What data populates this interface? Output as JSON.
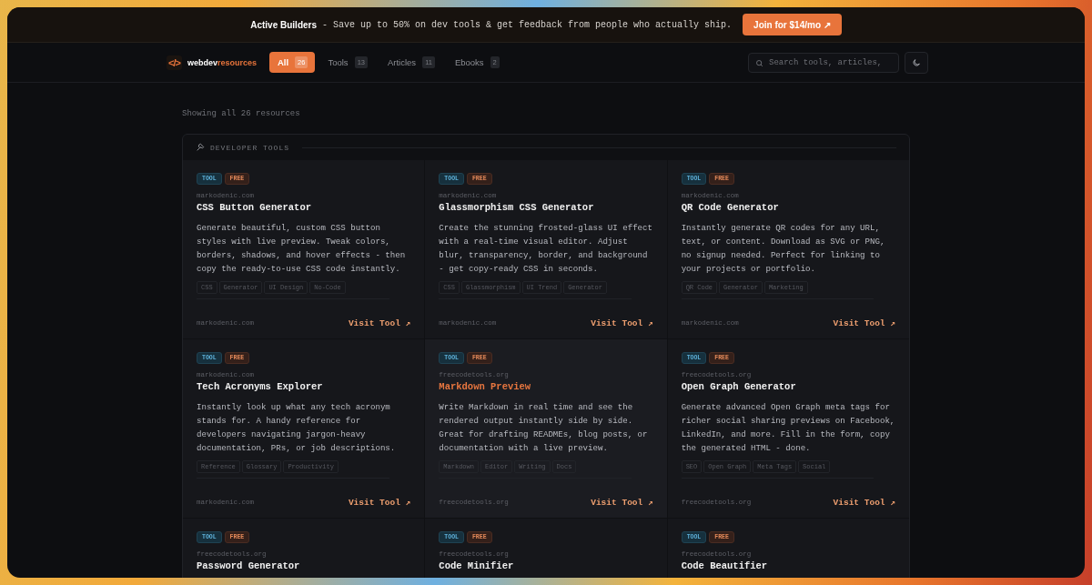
{
  "banner": {
    "title": "Active Builders",
    "text": "- Save up to 50% on dev tools & get feedback from people who actually ship.",
    "button": "Join for $14/mo ↗"
  },
  "nav": {
    "logo_mark": "</>",
    "logo_prefix": "webdev",
    "logo_suffix": "resources",
    "tabs": [
      {
        "label": "All",
        "count": "26",
        "selected": true
      },
      {
        "label": "Tools",
        "count": "13",
        "selected": false
      },
      {
        "label": "Articles",
        "count": "11",
        "selected": false
      },
      {
        "label": "Ebooks",
        "count": "2",
        "selected": false
      }
    ],
    "search": {
      "placeholder": "Search tools, articles,"
    }
  },
  "summary": "Showing all 26 resources",
  "section": {
    "title": "DEVELOPER TOOLS",
    "items": [
      {
        "type_badge": "TOOL",
        "price_badge": "FREE",
        "domain": "markodenic.com",
        "title": "CSS Button Generator",
        "description": "Generate beautiful, custom CSS button styles with live preview. Tweak colors, borders, shadows, and hover effects - then copy the ready-to-use CSS code instantly.",
        "tags": [
          "CSS",
          "Generator",
          "UI Design",
          "No-Code"
        ],
        "footer_domain": "markodenic.com",
        "link": "Visit Tool ↗",
        "highlighted": false
      },
      {
        "type_badge": "TOOL",
        "price_badge": "FREE",
        "domain": "markodenic.com",
        "title": "Glassmorphism CSS Generator",
        "description": "Create the stunning frosted-glass UI effect with a real-time visual editor. Adjust blur, transparency, border, and background - get copy-ready CSS in seconds.",
        "tags": [
          "CSS",
          "Glassmorphism",
          "UI Trend",
          "Generator"
        ],
        "footer_domain": "markodenic.com",
        "link": "Visit Tool ↗",
        "highlighted": false
      },
      {
        "type_badge": "TOOL",
        "price_badge": "FREE",
        "domain": "markodenic.com",
        "title": "QR Code Generator",
        "description": "Instantly generate QR codes for any URL, text, or content. Download as SVG or PNG, no signup needed. Perfect for linking to your projects or portfolio.",
        "tags": [
          "QR Code",
          "Generator",
          "Marketing"
        ],
        "footer_domain": "markodenic.com",
        "link": "Visit Tool ↗",
        "highlighted": false
      },
      {
        "type_badge": "TOOL",
        "price_badge": "FREE",
        "domain": "markodenic.com",
        "title": "Tech Acronyms Explorer",
        "description": "Instantly look up what any tech acronym stands for. A handy reference for developers navigating jargon-heavy documentation, PRs, or job descriptions.",
        "tags": [
          "Reference",
          "Glossary",
          "Productivity"
        ],
        "footer_domain": "markodenic.com",
        "link": "Visit Tool ↗",
        "highlighted": false
      },
      {
        "type_badge": "TOOL",
        "price_badge": "FREE",
        "domain": "freecodetools.org",
        "title": "Markdown Preview",
        "description": "Write Markdown in real time and see the rendered output instantly side by side. Great for drafting READMEs, blog posts, or documentation with a live preview.",
        "tags": [
          "Markdown",
          "Editor",
          "Writing",
          "Docs"
        ],
        "footer_domain": "freecodetools.org",
        "link": "Visit Tool ↗",
        "highlighted": true
      },
      {
        "type_badge": "TOOL",
        "price_badge": "FREE",
        "domain": "freecodetools.org",
        "title": "Open Graph Generator",
        "description": "Generate advanced Open Graph meta tags for richer social sharing previews on Facebook, LinkedIn, and more. Fill in the form, copy the generated HTML - done.",
        "tags": [
          "SEO",
          "Open Graph",
          "Meta Tags",
          "Social"
        ],
        "footer_domain": "freecodetools.org",
        "link": "Visit Tool ↗",
        "highlighted": false
      },
      {
        "type_badge": "TOOL",
        "price_badge": "FREE",
        "domain": "freecodetools.org",
        "title": "Password Generator",
        "highlighted": false
      },
      {
        "type_badge": "TOOL",
        "price_badge": "FREE",
        "domain": "freecodetools.org",
        "title": "Code Minifier",
        "highlighted": false
      },
      {
        "type_badge": "TOOL",
        "price_badge": "FREE",
        "domain": "freecodetools.org",
        "title": "Code Beautifier",
        "highlighted": false
      }
    ]
  }
}
